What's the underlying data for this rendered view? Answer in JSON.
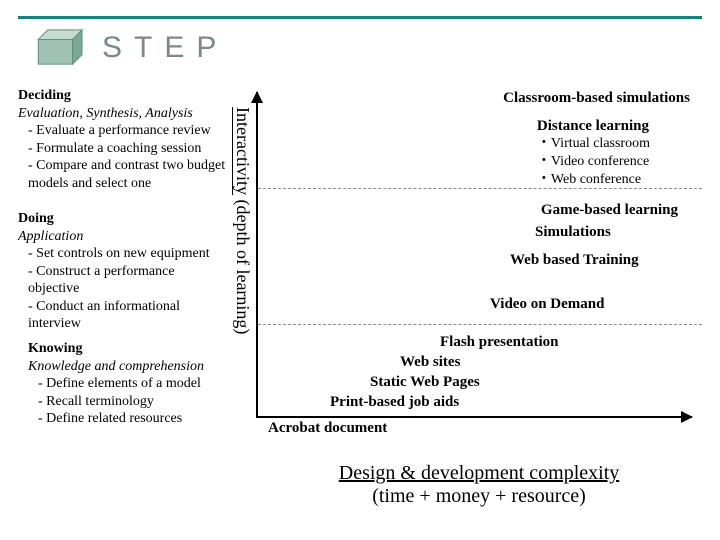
{
  "brand": "STEP",
  "axis": {
    "y_main": "Interactivity",
    "y_sub": " (depth of learning)",
    "x_main": "Design & development complexity",
    "x_sub": "(time + money + resource)"
  },
  "levels": {
    "deciding": {
      "title": "Deciding",
      "sub": "Evaluation, Synthesis, Analysis",
      "items": [
        "Evaluate a performance review",
        "Formulate a coaching session",
        "Compare and contrast two budget models and select one"
      ]
    },
    "doing": {
      "title": "Doing",
      "sub": "Application",
      "items": [
        "Set controls on new equipment",
        "Construct a performance objective",
        "Conduct an informational interview"
      ]
    },
    "knowing": {
      "title": "Knowing",
      "sub": "Knowledge and comprehension",
      "items": [
        "Define elements of a model",
        "Recall terminology",
        "Define related resources"
      ]
    }
  },
  "right": {
    "classroom": "Classroom-based simulations",
    "distance": "Distance learning",
    "distance_items": [
      "Virtual classroom",
      "Video conference",
      "Web conference"
    ],
    "game": "Game-based learning",
    "simulations": "Simulations",
    "wbt": "Web based Training",
    "vod": "Video on Demand",
    "flash": "Flash presentation",
    "websites": "Web sites",
    "static": "Static Web Pages",
    "print": "Print-based job aids",
    "acrobat": "Acrobat document"
  }
}
